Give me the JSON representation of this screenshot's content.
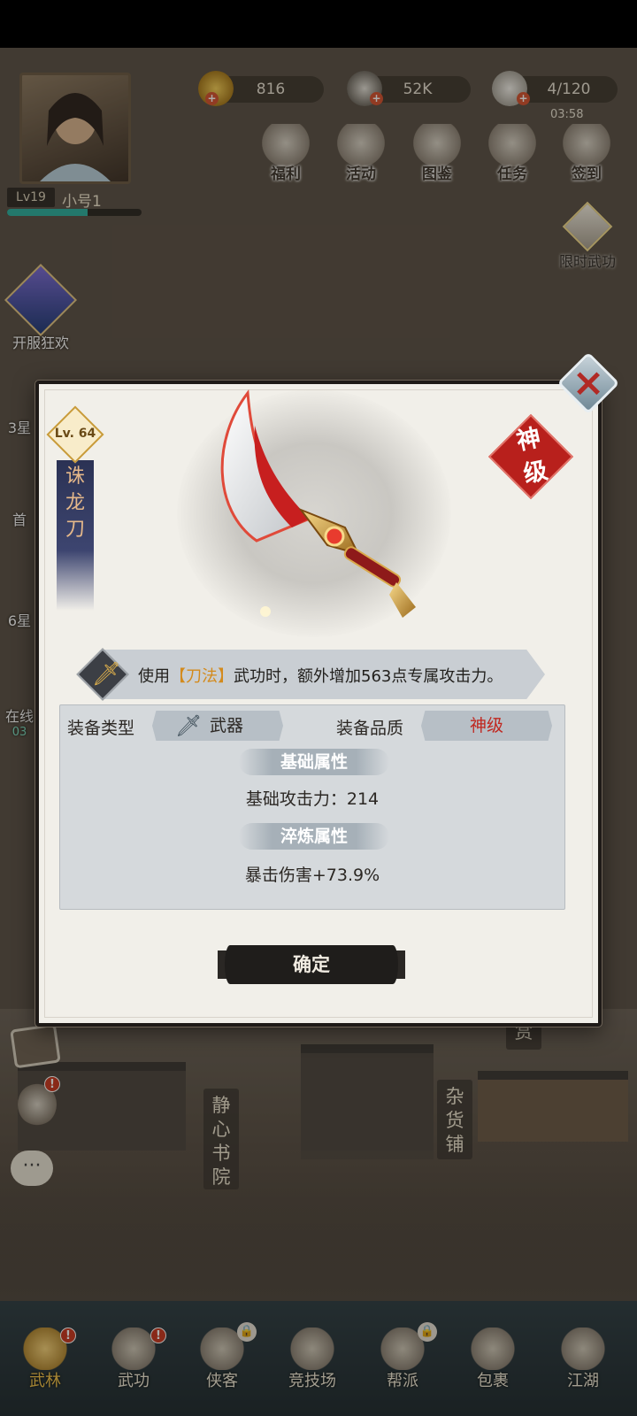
{
  "player": {
    "level": "Lv19",
    "name": "小号1",
    "exp_fraction": 0.6
  },
  "resources": [
    {
      "icon": "gold-ingot-icon",
      "value": "816"
    },
    {
      "icon": "coin-icon",
      "value": "52K"
    },
    {
      "icon": "stamina-bun-icon",
      "value": "4/120"
    }
  ],
  "timer": "03:58",
  "top_menu": [
    {
      "icon": "knot-icon",
      "label": "福利"
    },
    {
      "icon": "drum-icon",
      "label": "活动"
    },
    {
      "icon": "book-icon",
      "label": "图鉴"
    },
    {
      "icon": "scroll-icon",
      "label": "任务"
    },
    {
      "icon": "checkmark-icon",
      "label": "签到"
    }
  ],
  "limited_skill": {
    "label": "限时武功"
  },
  "left_sidebar": [
    {
      "label": "开服狂欢"
    },
    {
      "label": "3星"
    },
    {
      "label": "首"
    },
    {
      "label": "6星"
    },
    {
      "label": "在线",
      "sub": "03"
    }
  ],
  "town": {
    "signs": [
      "静心书院",
      "杂货铺",
      "悬赏"
    ]
  },
  "bottom_nav": [
    {
      "icon": "pagoda-icon",
      "label": "武林",
      "badge": "!",
      "active": true
    },
    {
      "icon": "scroll-book-icon",
      "label": "武功",
      "badge": "!"
    },
    {
      "icon": "hat-icon",
      "label": "侠客",
      "lock": true
    },
    {
      "icon": "crossed-swords-icon",
      "label": "竞技场"
    },
    {
      "icon": "banner-icon",
      "label": "帮派",
      "lock": true
    },
    {
      "icon": "bundle-icon",
      "label": "包裹"
    },
    {
      "icon": "mountain-icon",
      "label": "江湖"
    }
  ],
  "item": {
    "level": "Lv. 64",
    "name": "诛龙刀",
    "quality_stamp": "神级",
    "skill_prefix": "使用",
    "skill_highlight": "【刀法】",
    "skill_suffix": "武功时，额外增加563点专属攻击力。",
    "type_label": "装备类型",
    "type_value": "武器",
    "quality_label": "装备品质",
    "quality_value": "神级",
    "base_title": "基础属性",
    "base_stat": "基础攻击力：214",
    "refine_title": "淬炼属性",
    "refine_stat": "暴击伤害+73.9%",
    "confirm": "确定"
  },
  "colors": {
    "quality_red": "#c0271f",
    "highlight_orange": "#d38a1c",
    "nav_active": "#f3c44a"
  }
}
